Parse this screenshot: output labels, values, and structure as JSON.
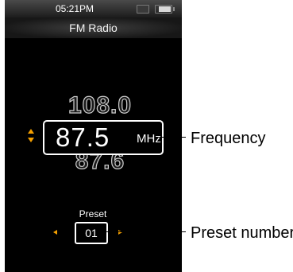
{
  "status_bar": {
    "time": "05:21PM",
    "icons": [
      "hold-icon",
      "battery-icon"
    ],
    "battery_level": 0.75
  },
  "header": {
    "title": "FM Radio"
  },
  "tuner": {
    "frequency_prev": "108.0",
    "frequency": "87.5",
    "unit": "MHz",
    "frequency_next": "87.6"
  },
  "preset": {
    "label": "Preset",
    "number": "01"
  },
  "callouts": {
    "frequency": "Frequency",
    "preset_number": "Preset number"
  },
  "colors": {
    "screen_bg": "#000000",
    "accent_arrow": "#f5a000",
    "text": "#ffffff"
  }
}
